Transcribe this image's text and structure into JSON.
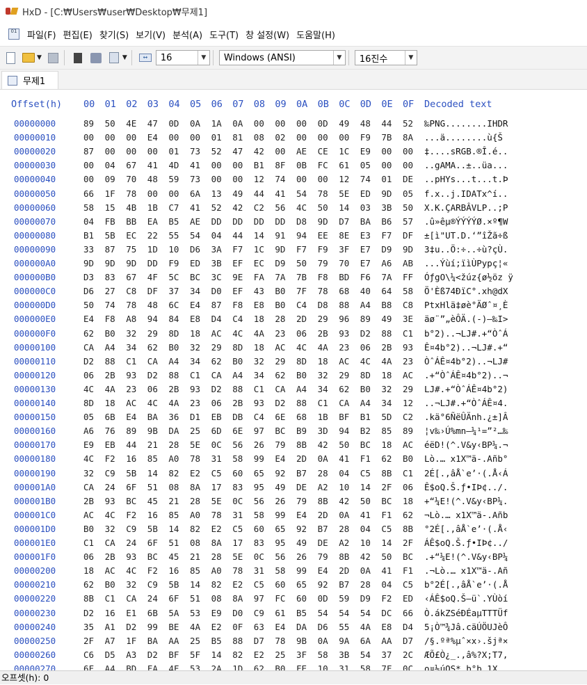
{
  "window": {
    "title": "HxD - [C:₩Users₩user₩Desktop₩무제1]"
  },
  "menu": [
    "파일(F)",
    "편집(E)",
    "찾기(S)",
    "보기(V)",
    "분석(A)",
    "도구(T)",
    "창 설정(W)",
    "도움말(H)"
  ],
  "toolbar": {
    "bytes_per_row": "16",
    "charset": "Windows (ANSI)",
    "offset_base": "16진수"
  },
  "tab": {
    "label": "무제1"
  },
  "header": {
    "offset": "Offset(h)",
    "columns": [
      "00",
      "01",
      "02",
      "03",
      "04",
      "05",
      "06",
      "07",
      "08",
      "09",
      "0A",
      "0B",
      "0C",
      "0D",
      "0E",
      "0F"
    ],
    "decoded": "Decoded text"
  },
  "rows": [
    {
      "offset": "00000000",
      "hex": "89 50 4E 47 0D 0A 1A 0A 00 00 00 0D 49 48 44 52",
      "text": "‰PNG........IHDR"
    },
    {
      "offset": "00000010",
      "hex": "00 00 00 E4 00 00 01 81 08 02 00 00 00 F9 7B 8A",
      "text": "...ä........ù{Š"
    },
    {
      "offset": "00000020",
      "hex": "87 00 00 00 01 73 52 47 42 00 AE CE 1C E9 00 00",
      "text": "‡....sRGB.®Î.é.."
    },
    {
      "offset": "00000030",
      "hex": "00 04 67 41 4D 41 00 00 B1 8F 0B FC 61 05 00 00",
      "text": "..gAMA..±..üa..."
    },
    {
      "offset": "00000040",
      "hex": "00 09 70 48 59 73 00 00 12 74 00 00 12 74 01 DE",
      "text": "..pHYs...t...t.Þ"
    },
    {
      "offset": "00000050",
      "hex": "66 1F 78 00 00 6A 13 49 44 41 54 78 5E ED 9D 05",
      "text": "f.x..j.IDATx^í.."
    },
    {
      "offset": "00000060",
      "hex": "58 15 4B 1B C7 41 52 42 C2 56 4C 50 14 03 3B 50",
      "text": "X.K.ÇARBÂVLP..;P"
    },
    {
      "offset": "00000070",
      "hex": "04 FB BB EA B5 AE DD DD DD DD D8 9D D7 BA B6 57",
      "text": ".û»êµ®ÝÝÝÝØ.×º¶W"
    },
    {
      "offset": "00000080",
      "hex": "B1 5B EC 22 55 54 04 44 14 91 94 EE 8E E3 F7 DF",
      "text": "±[ì\"UT.D.‘”îŽã÷ß"
    },
    {
      "offset": "00000090",
      "hex": "33 87 75 1D 10 D6 3A F7 1C 9D F7 F9 3F E7 D9 9D",
      "text": "3‡u..Ö:÷..÷ù?çÙ."
    },
    {
      "offset": "000000A0",
      "hex": "9D 9D 9D DD F9 ED 3B EF EC D9 50 79 70 E7 A6 AB",
      "text": "...Ýùí;ïìÙPypç¦«"
    },
    {
      "offset": "000000B0",
      "hex": "D3 83 67 4F 5C BC 3C 9E FA 7A 7B F8 BD F6 7A FF",
      "text": "ÓƒgO\\¼<žúz{ø½öz ÿ"
    },
    {
      "offset": "000000C0",
      "hex": "D6 27 C8 DF 37 34 D0 EF 43 B0 7F 78 68 40 64 58",
      "text": "Ö'Èß74ÐïC°.xh@dX"
    },
    {
      "offset": "000000D0",
      "hex": "50 74 78 48 6C E4 87 F8 E8 B0 C4 D8 88 A4 B8 C8",
      "text": "PtxHlä‡øè°ÄØˆ¤¸È"
    },
    {
      "offset": "000000E0",
      "hex": "E4 F8 A8 94 84 E8 D4 C4 18 28 2D 29 96 89 49 3E",
      "text": "äø¨”„èÔÄ.(-)–‰I>"
    },
    {
      "offset": "000000F0",
      "hex": "62 B0 32 29 8D 18 AC 4C 4A 23 06 2B 93 D2 88 C1",
      "text": "b°2)..¬LJ#.+“ÒˆÁ"
    },
    {
      "offset": "00000100",
      "hex": "CA A4 34 62 B0 32 29 8D 18 AC 4C 4A 23 06 2B 93",
      "text": "Ê¤4b°2)..¬LJ#.+“"
    },
    {
      "offset": "00000110",
      "hex": "D2 88 C1 CA A4 34 62 B0 32 29 8D 18 AC 4C 4A 23",
      "text": "ÒˆÁÊ¤4b°2)..¬LJ#"
    },
    {
      "offset": "00000120",
      "hex": "06 2B 93 D2 88 C1 CA A4 34 62 B0 32 29 8D 18 AC",
      "text": ".+“ÒˆÁÊ¤4b°2)..¬"
    },
    {
      "offset": "00000130",
      "hex": "4C 4A 23 06 2B 93 D2 88 C1 CA A4 34 62 B0 32 29",
      "text": "LJ#.+“ÒˆÁÊ¤4b°2)"
    },
    {
      "offset": "00000140",
      "hex": "8D 18 AC 4C 4A 23 06 2B 93 D2 88 C1 CA A4 34 12",
      "text": "..¬LJ#.+“ÒˆÁÊ¤4."
    },
    {
      "offset": "00000150",
      "hex": "05 6B E4 BA 36 D1 EB DB C4 6E 68 1B BF B1 5D C2",
      "text": ".kä°6ÑëÛÄnh.¿±]Â"
    },
    {
      "offset": "00000160",
      "hex": "A6 76 89 9B DA 25 6D 6E 97 BC B9 3D 94 B2 85 89",
      "text": "¦v‰›Ú%mn—¼¹=”²…‰"
    },
    {
      "offset": "00000170",
      "hex": "E9 EB 44 21 28 5E 0C 56 26 79 8B 42 50 BC 18 AC",
      "text": "éëD!(^.V&y‹BP¼.¬"
    },
    {
      "offset": "00000180",
      "hex": "4C F2 16 85 A0 78 31 58 99 E4 2D 0A 41 F1 62 B0",
      "text": "Lò.… x1X™ä-.Añb°"
    },
    {
      "offset": "00000190",
      "hex": "32 C9 5B 14 82 E2 C5 60 65 92 B7 28 04 C5 8B C1",
      "text": "2É[.‚âÅ`e’·(.Å‹Á"
    },
    {
      "offset": "000001A0",
      "hex": "CA 24 6F 51 08 8A 17 83 95 49 DE A2 10 14 2F 06",
      "text": "Ê$oQ.Š.ƒ•IÞ¢../."
    },
    {
      "offset": "000001B0",
      "hex": "2B 93 BC 45 21 28 5E 0C 56 26 79 8B 42 50 BC 18",
      "text": "+“¼E!(^.V&y‹BP¼."
    },
    {
      "offset": "000001C0",
      "hex": "AC 4C F2 16 85 A0 78 31 58 99 E4 2D 0A 41 F1 62",
      "text": "¬Lò.… x1X™ä-.Añb"
    },
    {
      "offset": "000001D0",
      "hex": "B0 32 C9 5B 14 82 E2 C5 60 65 92 B7 28 04 C5 8B",
      "text": "°2É[.‚âÅ`e’·(.Å‹"
    },
    {
      "offset": "000001E0",
      "hex": "C1 CA 24 6F 51 08 8A 17 83 95 49 DE A2 10 14 2F",
      "text": "ÁÊ$oQ.Š.ƒ•IÞ¢../"
    },
    {
      "offset": "000001F0",
      "hex": "06 2B 93 BC 45 21 28 5E 0C 56 26 79 8B 42 50 BC",
      "text": ".+“¼E!(^.V&y‹BP¼"
    },
    {
      "offset": "00000200",
      "hex": "18 AC 4C F2 16 85 A0 78 31 58 99 E4 2D 0A 41 F1",
      "text": ".¬Lò.… x1X™ä-.Añ"
    },
    {
      "offset": "00000210",
      "hex": "62 B0 32 C9 5B 14 82 E2 C5 60 65 92 B7 28 04 C5",
      "text": "b°2É[.‚âÅ`e’·(.Å"
    },
    {
      "offset": "00000220",
      "hex": "8B C1 CA 24 6F 51 08 8A 97 FC 60 0D 59 D9 F2 ED",
      "text": "‹ÁÊ$oQ.Š—ü`.YÙòí"
    },
    {
      "offset": "00000230",
      "hex": "D2 16 E1 6B 5A 53 E9 D0 C9 61 B5 54 54 54 DC 66",
      "text": "Ò.ákZSéÐÉaµTTTÜf"
    },
    {
      "offset": "00000240",
      "hex": "35 A1 D2 99 BE 4A E2 0F 63 E4 DA D6 55 4A E8 D4",
      "text": "5¡Ò™¾Jâ.cäÚÖUJèÔ"
    },
    {
      "offset": "00000250",
      "hex": "2F A7 1F BA AA 25 B5 88 D7 78 9B 0A 9A 6A AA D7",
      "text": "/§.ºª%µˆ×x›.šjª×"
    },
    {
      "offset": "00000260",
      "hex": "C6 D5 A3 D2 BF 5F 14 82 E2 25 3F 58 3B 54 37 2C",
      "text": "ÆÕ£Ò¿_.‚â%?X;T7,"
    },
    {
      "offset": "00000270",
      "hex": "6F A4 BD FA 4F 53 2A 1D 62 B0 FE 10 31 58 7F 0C",
      "text": "o¤½úOS*.b°þ.1X.."
    }
  ],
  "status": {
    "offset_label": "오프셋(h): 0"
  }
}
